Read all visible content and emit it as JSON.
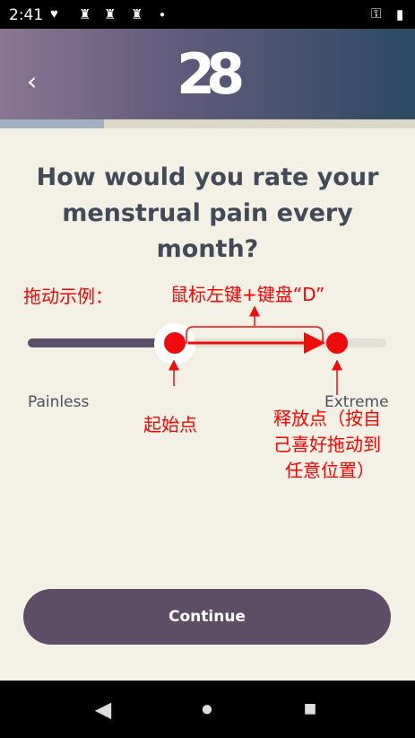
{
  "status_bar": {
    "time": "2:41",
    "icons": [
      "heart-pulse-icon",
      "chess-king-icon",
      "chess-king-icon",
      "chess-king-icon",
      "dot-icon",
      "key-icon",
      "battery-icon"
    ]
  },
  "header": {
    "back_label": "‹",
    "logo_text": "28",
    "progress": 0.25
  },
  "question": "How would you rate your menstrual pain every month?",
  "slider": {
    "min_label": "Painless",
    "max_label": "Extreme",
    "value": 0.41
  },
  "annotations": {
    "example_label": "拖动示例：",
    "action_label": "鼠标左键+键盘“D”",
    "start_label": "起始点",
    "release_label_1": "释放点（按自",
    "release_label_2": "己喜好拖动到",
    "release_label_3": "任意位置）"
  },
  "continue_label": "Continue",
  "nav": {
    "back_glyph": "◀",
    "home_glyph": "●",
    "recents_glyph": "■"
  },
  "colors": {
    "accent": "#5e4d66",
    "annotation": "#ff0000",
    "background": "#f3f1e6"
  }
}
